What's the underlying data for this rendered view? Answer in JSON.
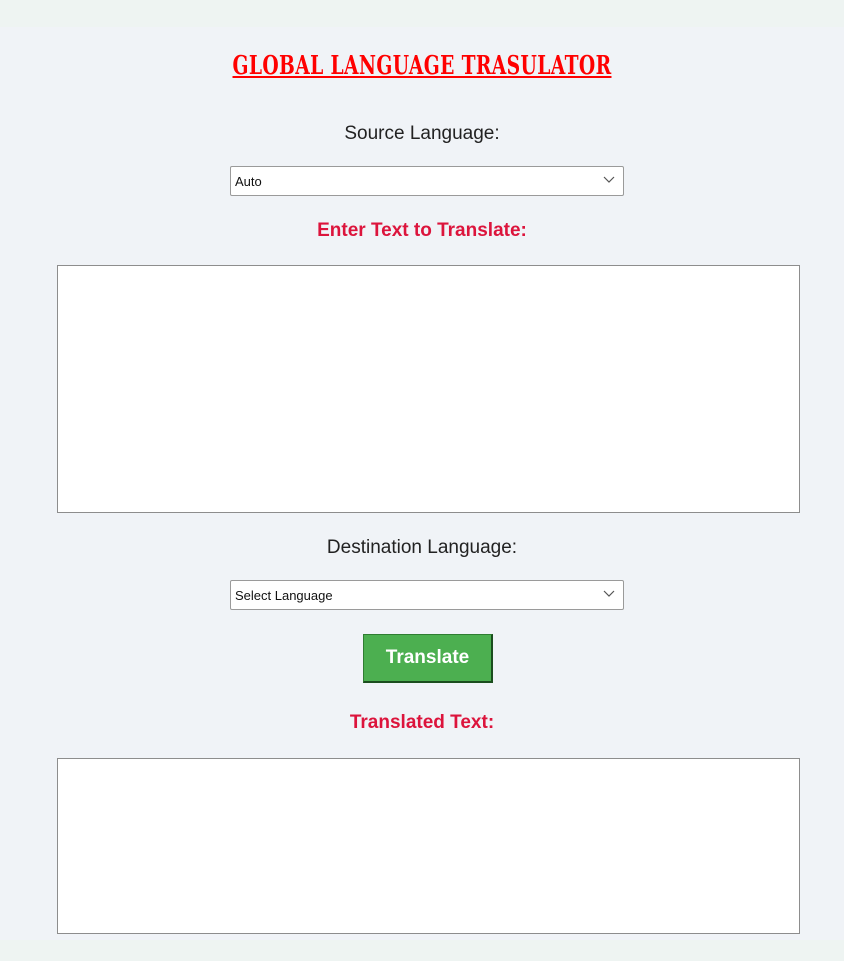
{
  "app": {
    "title": "GLOBAL LANGUAGE TRASULATOR"
  },
  "source": {
    "label": "Source Language:",
    "selected": "Auto"
  },
  "input": {
    "label": "Enter Text to Translate:",
    "value": ""
  },
  "destination": {
    "label": "Destination Language:",
    "selected": "Select Language"
  },
  "actions": {
    "translate_label": "Translate"
  },
  "output": {
    "label": "Translated Text:",
    "value": ""
  },
  "colors": {
    "title": "#ff0000",
    "accent_label": "#dc143c",
    "button": "#4caf50",
    "panel_bg": "#f0f3f7",
    "page_bg": "#eef4f2"
  },
  "icons": {
    "dropdown": "chevron-down-icon"
  }
}
